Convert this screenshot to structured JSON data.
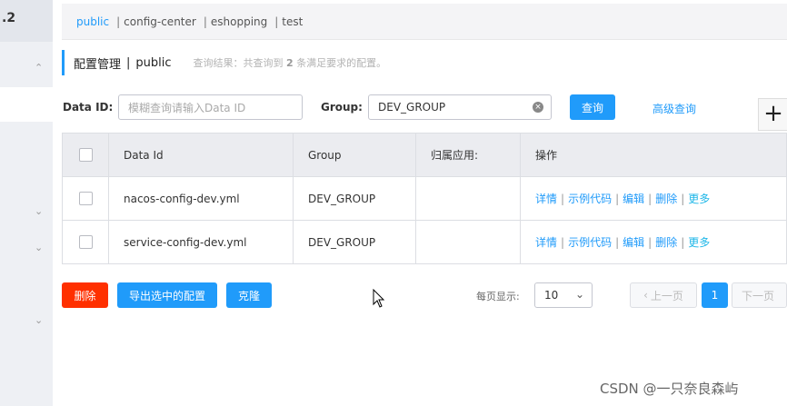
{
  "sidebar": {
    "version": ".2"
  },
  "namespaces": [
    {
      "label": "public",
      "active": true
    },
    {
      "label": "config-center",
      "active": false
    },
    {
      "label": "eshopping",
      "active": false
    },
    {
      "label": "test",
      "active": false
    }
  ],
  "title": {
    "text": "配置管理",
    "sep": "|",
    "namespace": "public",
    "result_prefix": "查询结果：共查询到",
    "result_count": "2",
    "result_suffix": "条满足要求的配置。"
  },
  "search": {
    "dataid_label": "Data ID:",
    "dataid_placeholder": "模糊查询请输入Data ID",
    "group_label": "Group:",
    "group_value": "DEV_GROUP",
    "query_button": "查询",
    "advanced_link": "高级查询",
    "plus": "+"
  },
  "table": {
    "headers": [
      "Data Id",
      "Group",
      "归属应用:",
      "操作"
    ],
    "rows": [
      {
        "data_id": "nacos-config-dev.yml",
        "group": "DEV_GROUP",
        "app": ""
      },
      {
        "data_id": "service-config-dev.yml",
        "group": "DEV_GROUP",
        "app": ""
      }
    ],
    "ops": {
      "detail": "详情",
      "sample": "示例代码",
      "edit": "编辑",
      "delete": "删除",
      "more": "更多",
      "sep": "|"
    }
  },
  "footer": {
    "delete_button": "删除",
    "export_button": "导出选中的配置",
    "clone_button": "克隆",
    "page_size_label": "每页显示:",
    "page_size": "10",
    "prev": "上一页",
    "current_page": "1",
    "next": "下一页"
  },
  "watermark": "CSDN @一只奈良森屿",
  "colors": {
    "accent": "#209bfa",
    "danger": "#ff3000"
  }
}
